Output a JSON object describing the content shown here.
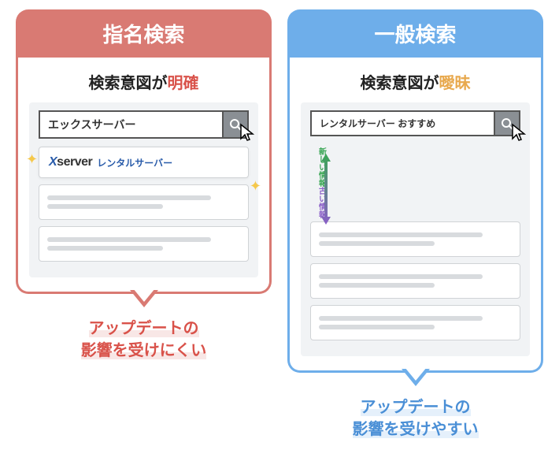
{
  "left": {
    "header": "指名検索",
    "subtitle_prefix": "検索意図が",
    "subtitle_highlight": "明確",
    "search_value": "エックスサーバー",
    "top_result_logo_x": "X",
    "top_result_logo_rest": "server",
    "top_result_sub": "レンタルサーバー",
    "footer_line1": "アップデートの",
    "footer_line2": "影響を受けにくい"
  },
  "right": {
    "header": "一般検索",
    "subtitle_prefix": "検索意図が",
    "subtitle_highlight": "曖昧",
    "search_value": "レンタルサーバー おすすめ",
    "side_label_top": "新しい情報",
    "side_label_bottom": "古い情報",
    "footer_line1": "アップデートの",
    "footer_line2": "影響を受けやすい"
  },
  "colors": {
    "red": "#d97a73",
    "blue": "#6eaeea"
  }
}
